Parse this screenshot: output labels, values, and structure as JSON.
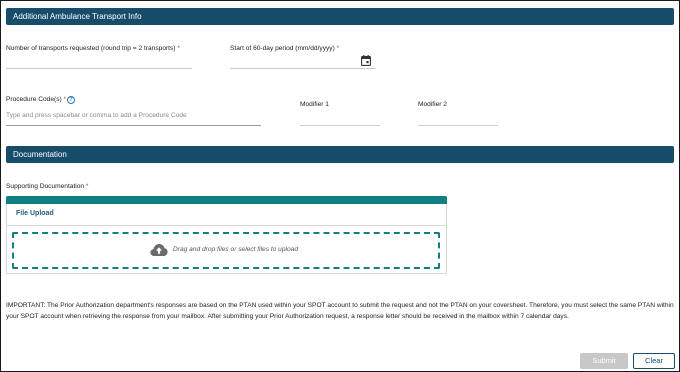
{
  "transport_section": {
    "title": "Additional Ambulance Transport Info",
    "num_transports_label": "Number of transports requested (round trip = 2 transports)",
    "start_period_label": "Start of 60-day period (mm/dd/yyyy)",
    "procedure_codes_label": "Procedure Code(s)",
    "procedure_codes_placeholder": "Type and press spacebar or comma to add a Procedure Code",
    "modifier1_label": "Modifier 1",
    "modifier2_label": "Modifier 2",
    "required_mark": "*"
  },
  "documentation_section": {
    "title": "Documentation",
    "supporting_label": "Supporting Documentation",
    "upload_tab_label": "File Upload",
    "drop_text": "Drag and drop files or select files to upload"
  },
  "notice": "IMPORTANT: The Prior Authorization department's responses are based on the PTAN used within your SPOT account to submit the request and not the PTAN on your coversheet. Therefore, you must select the same PTAN within your SPOT account when retrieving the response from your mailbox. After submitting your Prior Authorization request, a response letter should be received in the mailbox within 7 calendar days.",
  "buttons": {
    "submit": "Submit",
    "clear": "Clear"
  },
  "icons": {
    "calendar": "calendar-icon",
    "help": "help-icon",
    "upload": "cloud-upload-icon"
  },
  "colors": {
    "header_bg": "#174d6b",
    "accent_teal": "#117f83",
    "required": "#c0392b"
  }
}
